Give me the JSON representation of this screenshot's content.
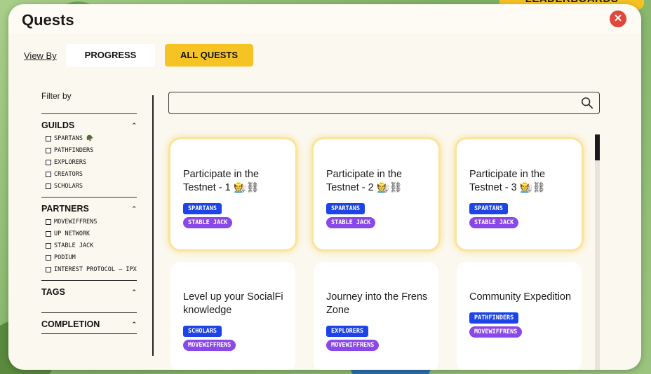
{
  "background": {
    "leaderboards_tab": "LEADERBOARDS"
  },
  "modal": {
    "title": "Quests",
    "close_glyph": "✕"
  },
  "view_by": {
    "label": "View By",
    "tabs": [
      {
        "label": "PROGRESS",
        "selected": false
      },
      {
        "label": "ALL QUESTS",
        "selected": true
      }
    ]
  },
  "filters": {
    "heading": "Filter by",
    "sections": [
      {
        "title": "GUILDS",
        "options": [
          "SPARTANS 🪖",
          "PATHFINDERS",
          "EXPLORERS",
          "CREATORS",
          "SCHOLARS"
        ]
      },
      {
        "title": "PARTNERS",
        "options": [
          "MOVEWIFFRENS",
          "UP NETWORK",
          "STABLE JACK",
          "PODIUM",
          "INTEREST PROTOCOL – IPX"
        ]
      },
      {
        "title": "TAGS",
        "options": []
      },
      {
        "title": "COMPLETION",
        "options": []
      }
    ]
  },
  "search": {
    "placeholder": "",
    "value": ""
  },
  "quests": [
    {
      "title": "Participate in the Testnet - 1 🧑‍🌾⛓",
      "guild": "SPARTANS",
      "partner": "STABLE JACK",
      "featured": true
    },
    {
      "title": "Participate in the Testnet - 2 🧑‍🌾⛓",
      "guild": "SPARTANS",
      "partner": "STABLE JACK",
      "featured": true
    },
    {
      "title": "Participate in the Testnet - 3 🧑‍🌾⛓",
      "guild": "SPARTANS",
      "partner": "STABLE JACK",
      "featured": true
    },
    {
      "title": "Level up your SocialFi knowledge",
      "guild": "SCHOLARS",
      "partner": "MOVEWIFFRENS",
      "featured": false
    },
    {
      "title": "Journey into the Frens Zone",
      "guild": "EXPLORERS",
      "partner": "MOVEWIFFRENS",
      "featured": false
    },
    {
      "title": "Community Expedition",
      "guild": "PATHFINDERS",
      "partner": "MOVEWIFFRENS",
      "featured": false
    }
  ],
  "colors": {
    "accent_yellow": "#f6c325",
    "guild_pill": "#1c44e6",
    "partner_pill": "#8a48e8",
    "close_red": "#e2473b"
  }
}
